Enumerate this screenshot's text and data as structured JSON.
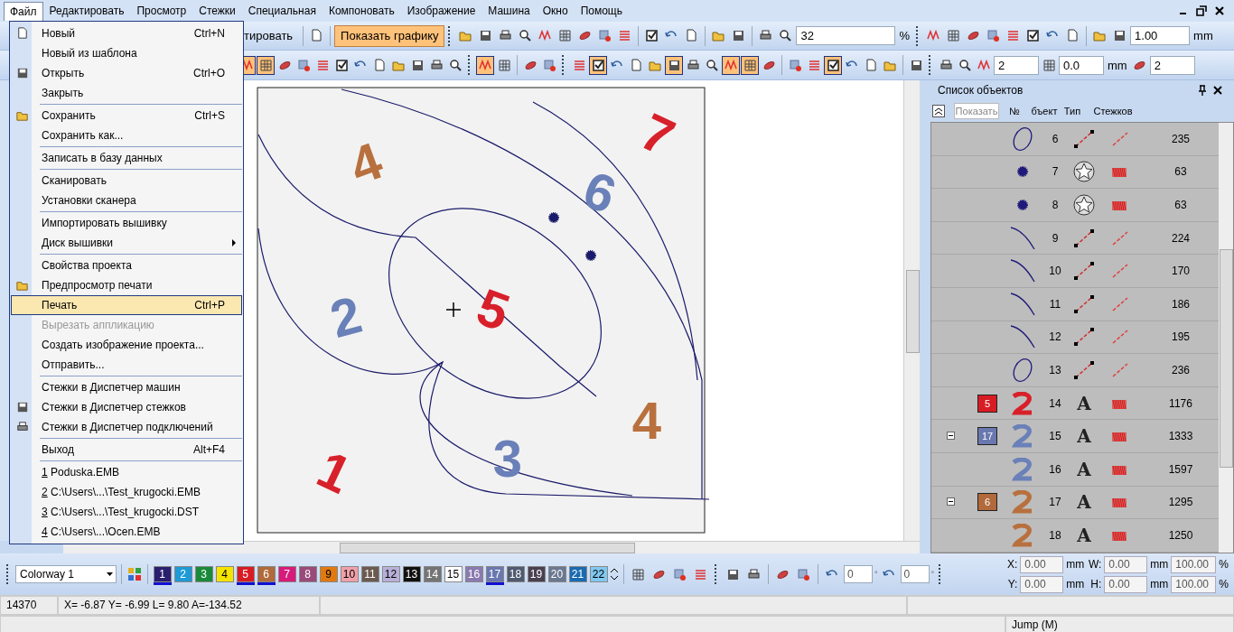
{
  "menu_bar": {
    "items": [
      {
        "label": "Файл",
        "selected": true
      },
      {
        "label": "Редактировать",
        "selected": false
      },
      {
        "label": "Просмотр",
        "selected": false
      },
      {
        "label": "Стежки",
        "selected": false
      },
      {
        "label": "Специальная",
        "selected": false
      },
      {
        "label": "Компоновать",
        "selected": false
      },
      {
        "label": "Изображение",
        "selected": false
      },
      {
        "label": "Машина",
        "selected": false
      },
      {
        "label": "Окно",
        "selected": false
      },
      {
        "label": "Помощь",
        "selected": false
      }
    ]
  },
  "file_menu": {
    "groups": [
      [
        {
          "label": "Новый",
          "shortcut": "Ctrl+N",
          "icon": true,
          "selected": false,
          "disabled": false
        },
        {
          "label": "Новый из шаблона",
          "icon": false,
          "selected": false,
          "disabled": false
        },
        {
          "label": "Открыть",
          "shortcut": "Ctrl+O",
          "icon": true,
          "selected": false,
          "disabled": false
        },
        {
          "label": "Закрыть",
          "icon": false,
          "selected": false,
          "disabled": false
        }
      ],
      [
        {
          "label": "Сохранить",
          "shortcut": "Ctrl+S",
          "icon": true,
          "selected": false,
          "disabled": false
        },
        {
          "label": "Сохранить как...",
          "icon": false,
          "selected": false,
          "disabled": false
        }
      ],
      [
        {
          "label": "Записать в базу данных",
          "icon": false,
          "selected": false,
          "disabled": false
        }
      ],
      [
        {
          "label": "Сканировать",
          "icon": false,
          "selected": false,
          "disabled": false
        },
        {
          "label": "Установки сканера",
          "icon": false,
          "selected": false,
          "disabled": false
        }
      ],
      [
        {
          "label": "Импортировать вышивку",
          "icon": false,
          "selected": false,
          "disabled": false
        },
        {
          "label": "Диск вышивки",
          "icon": false,
          "submenu": true,
          "selected": false,
          "disabled": false
        }
      ],
      [
        {
          "label": "Свойства проекта",
          "icon": false,
          "selected": false,
          "disabled": false
        },
        {
          "label": "Предпросмотр печати",
          "icon": true,
          "selected": false,
          "disabled": false
        },
        {
          "label": "Печать",
          "shortcut": "Ctrl+P",
          "icon": false,
          "selected": true,
          "disabled": false
        },
        {
          "label": "Вырезать аппликацию",
          "icon": false,
          "selected": false,
          "disabled": true
        },
        {
          "label": "Создать изображение проекта...",
          "icon": false,
          "selected": false,
          "disabled": false
        },
        {
          "label": "Отправить...",
          "icon": false,
          "selected": false,
          "disabled": false
        }
      ],
      [
        {
          "label": "Стежки в Диспетчер машин",
          "icon": false,
          "selected": false,
          "disabled": false
        },
        {
          "label": "Стежки в Диспетчер стежков",
          "icon": true,
          "selected": false,
          "disabled": false
        },
        {
          "label": "Стежки в Диспетчер подключений",
          "icon": true,
          "selected": false,
          "disabled": false
        }
      ],
      [
        {
          "label": "Выход",
          "shortcut": "Alt+F4",
          "icon": false,
          "selected": false,
          "disabled": false
        }
      ],
      [
        {
          "index": "1",
          "label": "Poduska.EMB",
          "icon": false,
          "selected": false,
          "disabled": false
        },
        {
          "index": "2",
          "label": "C:\\Users\\...\\Test_krugocki.EMB",
          "icon": false,
          "selected": false,
          "disabled": false
        },
        {
          "index": "3",
          "label": "C:\\Users\\...\\Test_krugocki.DST",
          "icon": false,
          "selected": false,
          "disabled": false
        },
        {
          "index": "4",
          "label": "C:\\Users\\...\\Ocen.EMB",
          "icon": false,
          "selected": false,
          "disabled": false
        }
      ]
    ]
  },
  "toolbar_1": [
    {
      "kind": "button",
      "label": "тировать",
      "on": false
    },
    {
      "kind": "sep"
    },
    {
      "kind": "icon",
      "on": false
    },
    {
      "kind": "sep"
    },
    {
      "kind": "button",
      "label": "Показать графику",
      "on": true
    },
    {
      "kind": "grip"
    },
    {
      "kind": "icon",
      "on": false
    },
    {
      "kind": "icon",
      "on": false
    },
    {
      "kind": "icon",
      "on": false
    },
    {
      "kind": "icon",
      "on": false
    },
    {
      "kind": "icon",
      "on": false
    },
    {
      "kind": "icon",
      "on": false
    },
    {
      "kind": "icon",
      "on": false
    },
    {
      "kind": "icon",
      "on": false
    },
    {
      "kind": "icon",
      "on": false
    },
    {
      "kind": "sep"
    },
    {
      "kind": "icon",
      "on": false
    },
    {
      "kind": "icon",
      "on": false
    },
    {
      "kind": "icon",
      "on": false
    },
    {
      "kind": "sep"
    },
    {
      "kind": "icon",
      "on": false
    },
    {
      "kind": "icon",
      "on": false
    },
    {
      "kind": "sep"
    },
    {
      "kind": "icon",
      "on": false
    },
    {
      "kind": "icon",
      "on": false
    },
    {
      "kind": "combo",
      "value": "32"
    },
    {
      "kind": "label",
      "label": "%"
    },
    {
      "kind": "grip"
    },
    {
      "kind": "icon",
      "on": false
    },
    {
      "kind": "icon",
      "on": false
    },
    {
      "kind": "icon",
      "on": false
    },
    {
      "kind": "icon",
      "on": false
    },
    {
      "kind": "icon",
      "on": false
    },
    {
      "kind": "icon",
      "on": false
    },
    {
      "kind": "icon",
      "on": false
    },
    {
      "kind": "icon",
      "on": false
    },
    {
      "kind": "sep"
    },
    {
      "kind": "icon",
      "on": false
    },
    {
      "kind": "icon",
      "on": false
    },
    {
      "kind": "spin",
      "value": "1.00"
    },
    {
      "kind": "label",
      "label": "mm"
    }
  ],
  "toolbar_2": [
    {
      "kind": "icon",
      "on": true
    },
    {
      "kind": "icon",
      "on": true
    },
    {
      "kind": "icon",
      "on": false
    },
    {
      "kind": "icon",
      "on": false
    },
    {
      "kind": "icon",
      "on": false
    },
    {
      "kind": "icon",
      "on": false
    },
    {
      "kind": "icon",
      "on": false
    },
    {
      "kind": "icon",
      "on": false
    },
    {
      "kind": "icon",
      "on": false
    },
    {
      "kind": "icon",
      "on": false
    },
    {
      "kind": "icon",
      "on": false
    },
    {
      "kind": "icon",
      "on": false
    },
    {
      "kind": "grip"
    },
    {
      "kind": "icon",
      "on": true
    },
    {
      "kind": "icon",
      "on": false
    },
    {
      "kind": "sep"
    },
    {
      "kind": "icon",
      "on": false
    },
    {
      "kind": "icon",
      "on": false
    },
    {
      "kind": "grip"
    },
    {
      "kind": "icon",
      "on": false
    },
    {
      "kind": "icon",
      "on": true
    },
    {
      "kind": "icon",
      "on": false
    },
    {
      "kind": "icon",
      "on": false
    },
    {
      "kind": "icon",
      "on": false
    },
    {
      "kind": "icon",
      "on": true
    },
    {
      "kind": "icon",
      "on": false
    },
    {
      "kind": "icon",
      "on": false
    },
    {
      "kind": "icon",
      "on": true
    },
    {
      "kind": "icon",
      "on": true
    },
    {
      "kind": "icon",
      "on": false
    },
    {
      "kind": "sep"
    },
    {
      "kind": "icon",
      "on": false
    },
    {
      "kind": "icon",
      "on": false
    },
    {
      "kind": "icon",
      "on": true
    },
    {
      "kind": "icon",
      "on": false
    },
    {
      "kind": "icon",
      "on": false
    },
    {
      "kind": "icon",
      "on": false
    },
    {
      "kind": "sep"
    },
    {
      "kind": "icon",
      "on": false
    },
    {
      "kind": "grip"
    },
    {
      "kind": "icon",
      "on": false
    },
    {
      "kind": "icon",
      "on": false
    },
    {
      "kind": "icon",
      "on": false
    },
    {
      "kind": "spin",
      "value": "2"
    },
    {
      "kind": "icon",
      "on": false
    },
    {
      "kind": "spin",
      "value": "0.0"
    },
    {
      "kind": "label",
      "label": "mm"
    },
    {
      "kind": "icon",
      "on": false
    },
    {
      "kind": "spin",
      "value": "2"
    }
  ],
  "design": {
    "digits": [
      {
        "text": "4",
        "color": "#b8703e"
      },
      {
        "text": "7",
        "color": "#d8202a"
      },
      {
        "text": "6",
        "color": "#6a80b8"
      },
      {
        "text": "2",
        "color": "#6a80b8"
      },
      {
        "text": "5",
        "color": "#d8202a"
      },
      {
        "text": "4",
        "color": "#b8703e"
      },
      {
        "text": "3",
        "color": "#6a80b8"
      },
      {
        "text": "1",
        "color": "#d8202a"
      }
    ]
  },
  "object_list": {
    "title": "Список объектов",
    "show_button": "Показать",
    "columns": [
      "№",
      "бъект",
      "Тип",
      "Стежков"
    ],
    "rows": [
      {
        "kind": "ellipse",
        "number": "6",
        "stitches": "235",
        "color": "#1e1a7a"
      },
      {
        "kind": "star",
        "number": "7",
        "stitches": "63",
        "color": "#1e1a7a"
      },
      {
        "kind": "star",
        "number": "8",
        "stitches": "63",
        "color": "#1e1a7a"
      },
      {
        "kind": "curve",
        "number": "9",
        "stitches": "224",
        "color": "#1e1a7a"
      },
      {
        "kind": "curve",
        "number": "10",
        "stitches": "170",
        "color": "#1e1a7a"
      },
      {
        "kind": "curve",
        "number": "11",
        "stitches": "186",
        "color": "#1e1a7a"
      },
      {
        "kind": "curve",
        "number": "12",
        "stitches": "195",
        "color": "#1e1a7a"
      },
      {
        "kind": "ellipse",
        "number": "13",
        "stitches": "236",
        "color": "#1e1a7a"
      },
      {
        "kind": "lettering",
        "number": "14",
        "stitches": "1176",
        "color": "#d8202a",
        "object_text": "A",
        "chip": {
          "label": "5",
          "color": "#d81c24"
        }
      },
      {
        "kind": "lettering",
        "number": "15",
        "stitches": "1333",
        "color": "#6a80b8",
        "object_text": "A",
        "chip": {
          "label": "17",
          "color": "#6a78b0"
        },
        "expanded": true
      },
      {
        "kind": "lettering",
        "number": "16",
        "stitches": "1597",
        "color": "#6a80b8",
        "object_text": "A"
      },
      {
        "kind": "lettering",
        "number": "17",
        "stitches": "1295",
        "color": "#b8703e",
        "object_text": "A",
        "chip": {
          "label": "6",
          "color": "#b06a3c"
        },
        "expanded": true
      },
      {
        "kind": "lettering",
        "number": "18",
        "stitches": "1250",
        "color": "#b8703e",
        "object_text": "A"
      }
    ]
  },
  "colorway": {
    "value": "Colorway 1"
  },
  "palette": [
    {
      "label": "1",
      "color": "#2a1f6e",
      "used": true
    },
    {
      "label": "2",
      "color": "#1e9ad6",
      "used": false
    },
    {
      "label": "3",
      "color": "#1a8a3a",
      "used": false
    },
    {
      "label": "4",
      "color": "#f5e400",
      "used": false
    },
    {
      "label": "5",
      "color": "#d81c24",
      "used": true
    },
    {
      "label": "6",
      "color": "#b06a3c",
      "used": true
    },
    {
      "label": "7",
      "color": "#d81a7a",
      "used": false
    },
    {
      "label": "8",
      "color": "#9a4a7a",
      "used": false
    },
    {
      "label": "9",
      "color": "#e07a10",
      "used": false
    },
    {
      "label": "10",
      "color": "#f0a0a8",
      "used": false
    },
    {
      "label": "11",
      "color": "#6a5a50",
      "used": false
    },
    {
      "label": "12",
      "color": "#b8b0d8",
      "used": false
    },
    {
      "label": "13",
      "color": "#111111",
      "used": false
    },
    {
      "label": "14",
      "color": "#747474",
      "used": false
    },
    {
      "label": "15",
      "color": "#ffffff",
      "used": false
    },
    {
      "label": "16",
      "color": "#8a7ab0",
      "used": false
    },
    {
      "label": "17",
      "color": "#6a78b0",
      "used": true
    },
    {
      "label": "18",
      "color": "#505a70",
      "used": false
    },
    {
      "label": "19",
      "color": "#4a4050",
      "used": false
    },
    {
      "label": "20",
      "color": "#6a7890",
      "used": false
    },
    {
      "label": "21",
      "color": "#1a6ab0",
      "used": false
    },
    {
      "label": "22",
      "color": "#80c8f0",
      "used": false
    }
  ],
  "rotate_fields": [
    {
      "value": "0",
      "unit": "°"
    },
    {
      "value": "0",
      "unit": "°"
    }
  ],
  "transform": [
    {
      "label": "X:",
      "value": "0.00",
      "unit": "mm",
      "label2": "W:",
      "value2": "0.00",
      "unit2": "mm",
      "scale": "100.00",
      "pct": "%"
    },
    {
      "label": "Y:",
      "value": "0.00",
      "unit": "mm",
      "label2": "H:",
      "value2": "0.00",
      "unit2": "mm",
      "scale": "100.00",
      "pct": "%"
    }
  ],
  "status_bar": {
    "stitch_count": "14370",
    "coords": "X=  -6.87 Y=  -6.99 L=   9.80 A=-134.52",
    "mode": "Jump (M)"
  }
}
